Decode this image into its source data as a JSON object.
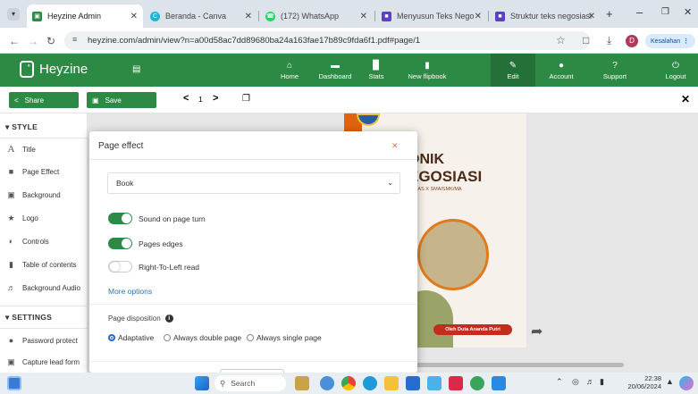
{
  "browser": {
    "tabs": [
      {
        "title": "Heyzine Admin",
        "icon": "heyzine-icon",
        "color": "#2d8a45"
      },
      {
        "title": "Beranda - Canva",
        "icon": "canva-icon",
        "color": "#1fb6d6"
      },
      {
        "title": "(172) WhatsApp",
        "icon": "whatsapp-icon",
        "color": "#25d366"
      },
      {
        "title": "Menyusun Teks Negosias",
        "icon": "slides-icon",
        "color": "#5b3fc4"
      },
      {
        "title": "Struktur teks negosiasi",
        "icon": "slides-icon",
        "color": "#5b3fc4"
      }
    ],
    "url": "heyzine.com/admin/view?n=a00d58ac7dd89680ba24a163fae17b89c9fda6f1.pdf#page/1",
    "profile_initial": "D",
    "error_label": "Kesalahan"
  },
  "app": {
    "logo": "Heyzine",
    "nav": [
      {
        "label": "Home",
        "icon": "home-icon"
      },
      {
        "label": "Dashboard",
        "icon": "dashboard-icon"
      },
      {
        "label": "Stats",
        "icon": "stats-icon"
      },
      {
        "label": "New flipbook",
        "icon": "new-flipbook-icon"
      },
      {
        "label": "Edit",
        "icon": "edit-icon"
      },
      {
        "label": "Account",
        "icon": "account-icon"
      },
      {
        "label": "Support",
        "icon": "support-icon"
      },
      {
        "label": "Logout",
        "icon": "logout-icon"
      }
    ],
    "accent": "#2d8a45"
  },
  "toolbar": {
    "share": "Share",
    "save": "Save",
    "page": "1"
  },
  "sidebar": {
    "style_header": "STYLE",
    "style_items": [
      {
        "label": "Title",
        "icon": "title-icon"
      },
      {
        "label": "Page Effect",
        "icon": "page-effect-icon"
      },
      {
        "label": "Background",
        "icon": "background-icon"
      },
      {
        "label": "Logo",
        "icon": "logo-star-icon"
      },
      {
        "label": "Controls",
        "icon": "controls-icon"
      },
      {
        "label": "Table of contents",
        "icon": "bookmark-icon"
      },
      {
        "label": "Background Audio",
        "icon": "audio-icon"
      }
    ],
    "settings_header": "SETTINGS",
    "settings_items": [
      {
        "label": "Password protect",
        "icon": "lock-icon"
      },
      {
        "label": "Capture lead form",
        "icon": "form-icon"
      }
    ]
  },
  "modal": {
    "title": "Page effect",
    "effect_value": "Book",
    "toggles": [
      {
        "label": "Sound on page turn",
        "on": true
      },
      {
        "label": "Pages edges",
        "on": true
      },
      {
        "label": "Right-To-Left read",
        "on": false
      }
    ],
    "more_options": "More options",
    "disposition_label": "Page disposition",
    "disposition_options": [
      {
        "label": "Adaptative",
        "selected": true
      },
      {
        "label": "Always double page",
        "selected": false
      },
      {
        "label": "Always single page",
        "selected": false
      }
    ]
  },
  "book": {
    "line1": "ONIK",
    "line2": "EGOSIASI",
    "subtitle": "KELAS X SMA/SMK/MA",
    "author": "Oleh Duta Ananda Putri"
  },
  "taskbar": {
    "search": "Search",
    "time": "22:38",
    "date": "20/06/2024"
  }
}
